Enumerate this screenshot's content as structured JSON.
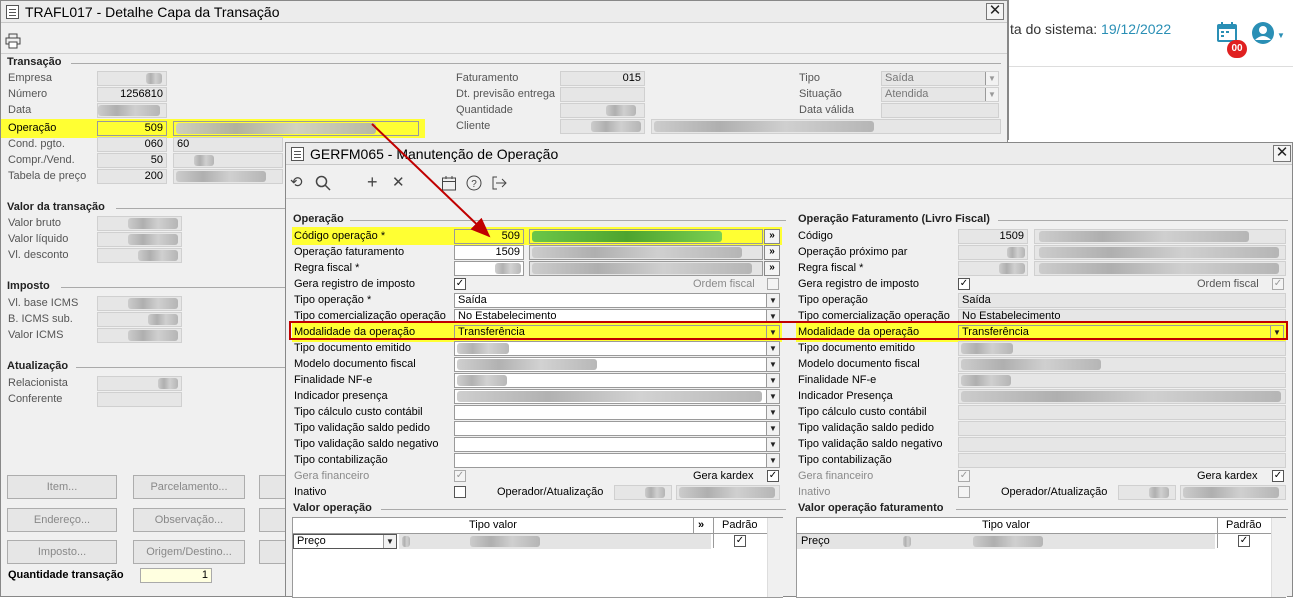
{
  "bg": {
    "date_label": "ta do sistema:",
    "date_value": "19/12/2022",
    "badge": "00"
  },
  "win1": {
    "title": "TRAFL017 - Detalhe Capa da Transação",
    "close": "✕",
    "transacao": {
      "title": "Transação",
      "empresa": "Empresa",
      "numero": "Número",
      "numero_value": "1256810",
      "data": "Data",
      "operacao": "Operação",
      "operacao_value": "509",
      "cond": "Cond. pgto.",
      "cond_value": "060",
      "cond_value2": "60",
      "compr": "Compr./Vend.",
      "compr_value": "50",
      "tabela": "Tabela de preço",
      "tabela_value": "200",
      "faturamento": "Faturamento",
      "faturamento_value": "015",
      "dt_prev": "Dt. previsão entrega",
      "quantidade": "Quantidade",
      "cliente": "Cliente",
      "tipo": "Tipo",
      "tipo_value": "Saída",
      "situacao": "Situação",
      "situacao_value": "Atendida",
      "data_valida": "Data válida"
    },
    "valor": {
      "title": "Valor da transação",
      "bruto": "Valor bruto",
      "liquido": "Valor líquido",
      "desconto": "Vl. desconto"
    },
    "imposto": {
      "title": "Imposto",
      "base": "Vl. base ICMS",
      "sub": "B. ICMS sub.",
      "valor": "Valor ICMS"
    },
    "atualizacao": {
      "title": "Atualização",
      "relacionista": "Relacionista",
      "conferente": "Conferente"
    },
    "buttons": {
      "item": "Item...",
      "parcelamento": "Parcelamento...",
      "endereco": "Endereço...",
      "observacao": "Observação...",
      "imposto": "Imposto...",
      "origem": "Origem/Destino..."
    },
    "qtd_label": "Quantidade transação",
    "qtd_value": "1"
  },
  "win2": {
    "title": "GERFM065 - Manutenção de Operação",
    "close": "✕",
    "left": {
      "title": "Operação",
      "codigo": "Código operação *",
      "codigo_value": "509",
      "op_fat": "Operação faturamento",
      "op_fat_value": "1509",
      "regra": "Regra fiscal *",
      "gera_reg": "Gera registro de imposto",
      "ordem": "Ordem fiscal",
      "tipo_op": "Tipo operação *",
      "tipo_op_value": "Saída",
      "tipo_com": "Tipo comercialização operação",
      "tipo_com_value": "No Estabelecimento",
      "modalidade": "Modalidade da operação",
      "modalidade_value": "Transferência",
      "tipo_doc": "Tipo documento emitido",
      "modelo": "Modelo documento fiscal",
      "finalidade": "Finalidade NF-e",
      "indicador": "Indicador presença",
      "tipo_calc": "Tipo cálculo custo contábil",
      "tipo_val_ped": "Tipo validação saldo pedido",
      "tipo_val_neg": "Tipo validação saldo negativo",
      "tipo_cont": "Tipo contabilização",
      "gera_fin": "Gera financeiro",
      "gera_kardex": "Gera kardex",
      "inativo": "Inativo",
      "operador": "Operador/Atualização"
    },
    "right": {
      "title": "Operação Faturamento (Livro Fiscal)",
      "codigo": "Código",
      "codigo_value": "1509",
      "op_prox": "Operação próximo par",
      "regra": "Regra fiscal *",
      "gera_reg": "Gera registro de imposto",
      "ordem": "Ordem fiscal",
      "tipo_op": "Tipo operação",
      "tipo_op_value": "Saída",
      "tipo_com": "Tipo comercialização operação",
      "tipo_com_value": "No Estabelecimento",
      "modalidade": "Modalidade da operação",
      "modalidade_value": "Transferência",
      "tipo_doc": "Tipo documento emitido",
      "modelo": "Modelo documento fiscal",
      "finalidade": "Finalidade NF-e",
      "indicador": "Indicador Presença",
      "tipo_calc": "Tipo cálculo custo contábil",
      "tipo_val_ped": "Tipo validação saldo pedido",
      "tipo_val_neg": "Tipo validação saldo negativo",
      "tipo_cont": "Tipo contabilização",
      "gera_fin": "Gera financeiro",
      "gera_kardex": "Gera kardex",
      "inativo": "Inativo",
      "operador": "Operador/Atualização"
    },
    "valor_op": {
      "title": "Valor operação",
      "col_tipo": "Tipo valor",
      "col_padrao": "Padrão",
      "row_value": "Preço"
    },
    "valor_fat": {
      "title": "Valor operação faturamento",
      "col_tipo": "Tipo valor",
      "col_padrao": "Padrão",
      "row_value": "Preço"
    }
  },
  "colors": {
    "highlight": "#ffff33",
    "red_box": "#c00000",
    "arrow": "#c00000",
    "date": "#2a8fb5"
  },
  "glyphs": {
    "chevron": "▼",
    "double_chevron": "»",
    "check": "✓"
  }
}
